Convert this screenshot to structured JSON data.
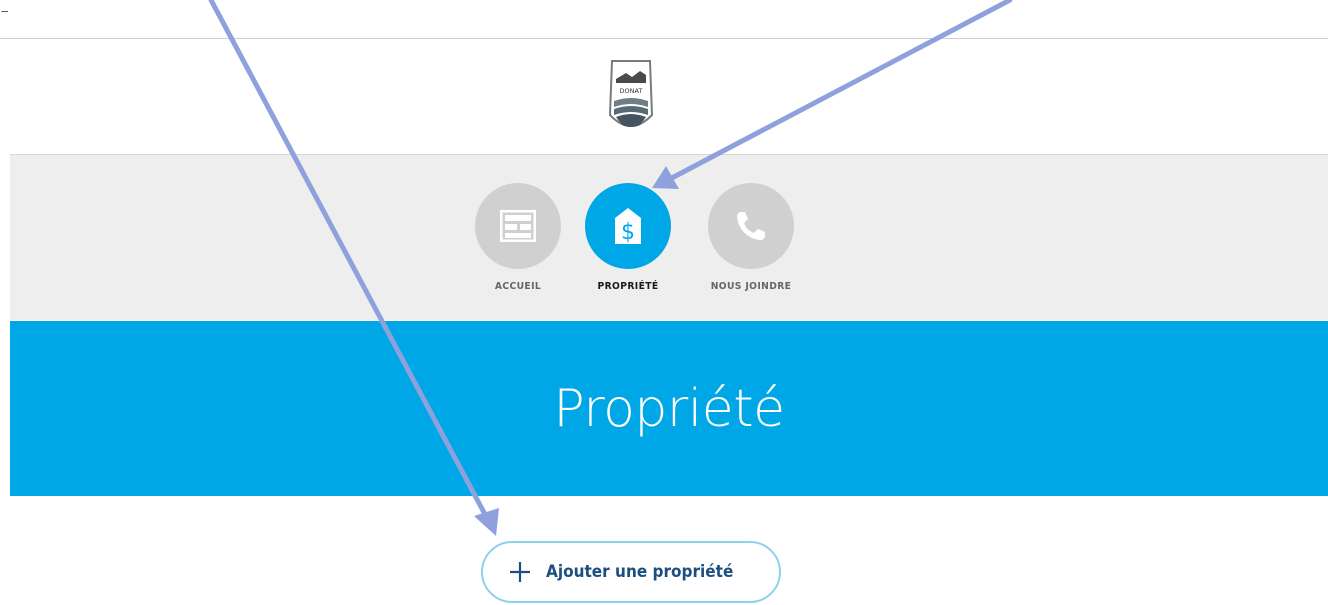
{
  "top_strip": {
    "marker": "--"
  },
  "logo": {
    "text": "DONAT",
    "icon": "municipal-logo"
  },
  "nav": {
    "items": [
      {
        "label": "ACCUEIL",
        "icon": "home-grid-icon",
        "active": false
      },
      {
        "label": "PROPRIÉTÉ",
        "icon": "house-dollar-icon",
        "active": true
      },
      {
        "label": "NOUS JOINDRE",
        "icon": "phone-icon",
        "active": false
      }
    ]
  },
  "banner": {
    "title": "Propriété"
  },
  "add_button": {
    "label": "Ajouter une propriété",
    "icon": "plus-icon"
  },
  "colors": {
    "accent": "#00a7e6",
    "inactive_icon_bg": "#d0d0d0",
    "nav_bg": "#eeeeee",
    "button_text": "#1c4f80",
    "annotation_arrow": "#8fa1dc"
  }
}
